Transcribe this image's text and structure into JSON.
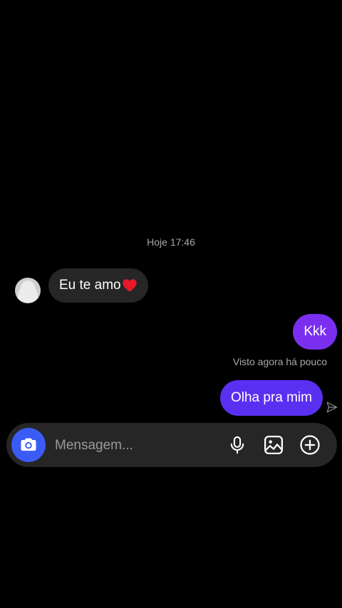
{
  "chat": {
    "timestamp": "Hoje 17:46",
    "incoming": [
      {
        "text": "Eu te amo",
        "emoji": "heart-emoji"
      }
    ],
    "outgoing": [
      {
        "text": "Kkk",
        "color": "#7a2ff0"
      },
      {
        "text": "Olha pra mim",
        "color": "#5b2ff2"
      }
    ],
    "seen_status": "Visto agora há pouco"
  },
  "composer": {
    "placeholder": "Mensagem...",
    "camera_color": "#3a5cf5",
    "icons": [
      "camera-icon",
      "microphone-icon",
      "gallery-icon",
      "plus-circle-icon"
    ]
  }
}
